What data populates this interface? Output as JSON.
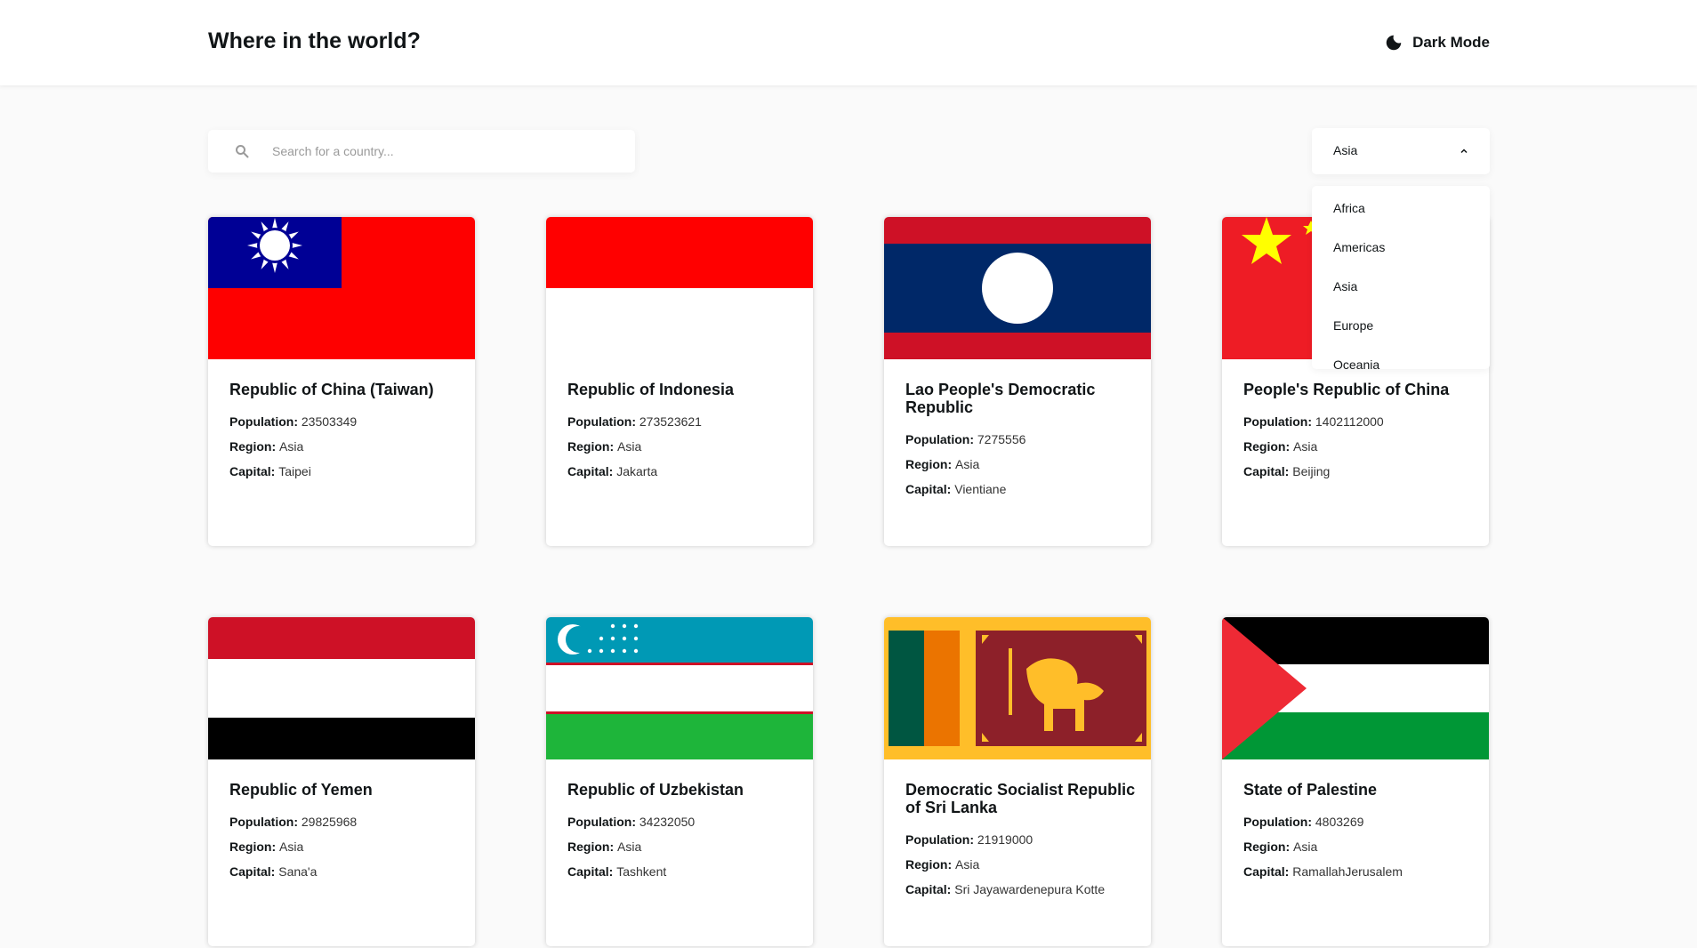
{
  "header": {
    "title": "Where in the world?",
    "mode_label": "Dark Mode",
    "mode_icon": "moon-icon"
  },
  "search": {
    "placeholder": "Search for a country...",
    "value": "",
    "icon": "search-icon"
  },
  "filter": {
    "selected": "Asia",
    "icon": "chevron-up-icon",
    "options": [
      "Africa",
      "Americas",
      "Asia",
      "Europe",
      "Oceania"
    ]
  },
  "labels": {
    "population": "Population:",
    "region": "Region:",
    "capital": "Capital:"
  },
  "countries": [
    {
      "name": "Republic of China (Taiwan)",
      "population": "23503349",
      "region": "Asia",
      "capital": "Taipei",
      "flag": "taiwan-flag"
    },
    {
      "name": "Republic of Indonesia",
      "population": "273523621",
      "region": "Asia",
      "capital": "Jakarta",
      "flag": "indonesia-flag"
    },
    {
      "name": "Lao People's Democratic Republic",
      "population": "7275556",
      "region": "Asia",
      "capital": "Vientiane",
      "flag": "laos-flag"
    },
    {
      "name": "People's Republic of China",
      "population": "1402112000",
      "region": "Asia",
      "capital": "Beijing",
      "flag": "china-flag"
    },
    {
      "name": "Republic of Yemen",
      "population": "29825968",
      "region": "Asia",
      "capital": "Sana'a",
      "flag": "yemen-flag"
    },
    {
      "name": "Republic of Uzbekistan",
      "population": "34232050",
      "region": "Asia",
      "capital": "Tashkent",
      "flag": "uzbekistan-flag"
    },
    {
      "name": "Democratic Socialist Republic of Sri Lanka",
      "population": "21919000",
      "region": "Asia",
      "capital": "Sri Jayawardenepura Kotte",
      "flag": "sri-lanka-flag"
    },
    {
      "name": "State of Palestine",
      "population": "4803269",
      "region": "Asia",
      "capital": "RamallahJerusalem",
      "flag": "palestine-flag"
    }
  ],
  "colors": {
    "background": "#fafafa",
    "element": "#ffffff",
    "text": "#111517"
  }
}
